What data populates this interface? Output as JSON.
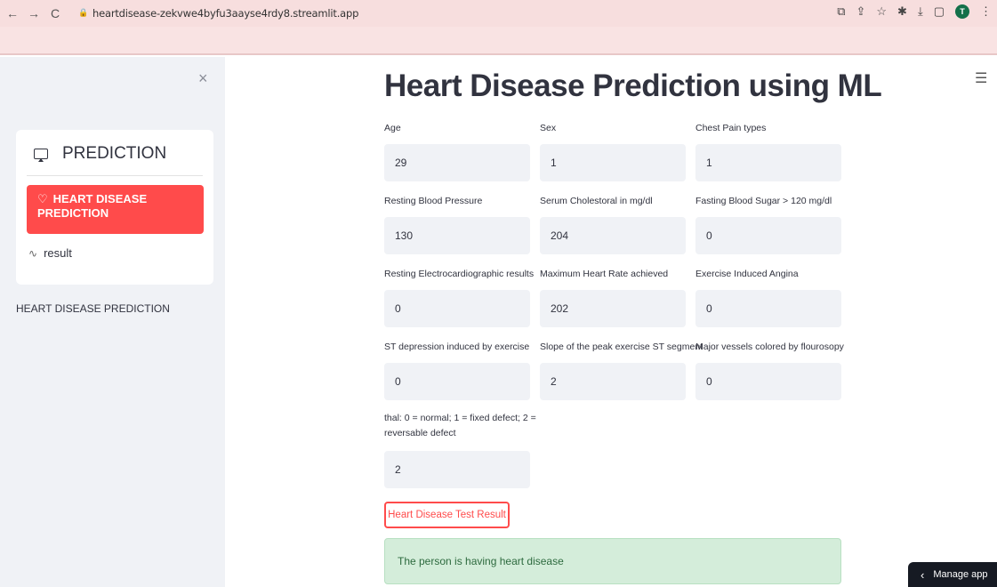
{
  "browser": {
    "url": "heartdisease-zekvwe4byfu3aayse4rdy8.streamlit.app",
    "back": "←",
    "forward": "→",
    "reload": "C",
    "avatar_letter": "T"
  },
  "sidebar": {
    "close_icon": "×",
    "menu_title": "PREDICTION",
    "items": [
      {
        "label": "HEART DISEASE PREDICTION",
        "icon": "heart-icon",
        "active": true
      },
      {
        "label": "result",
        "icon": "pulse-icon",
        "active": false
      }
    ],
    "caption": "HEART DISEASE PREDICTION"
  },
  "main": {
    "title": "Heart Disease Prediction using ML",
    "fields": [
      {
        "label": "Age",
        "value": "29"
      },
      {
        "label": "Sex",
        "value": "1"
      },
      {
        "label": "Chest Pain types",
        "value": "1"
      },
      {
        "label": "Resting Blood Pressure",
        "value": "130"
      },
      {
        "label": "Serum Cholestoral in mg/dl",
        "value": "204"
      },
      {
        "label": "Fasting Blood Sugar > 120 mg/dl",
        "value": "0"
      },
      {
        "label": "Resting Electrocardiographic results",
        "value": "0"
      },
      {
        "label": "Maximum Heart Rate achieved",
        "value": "202"
      },
      {
        "label": "Exercise Induced Angina",
        "value": "0"
      },
      {
        "label": "ST depression induced by exercise",
        "value": "0"
      },
      {
        "label": "Slope of the peak exercise ST segment",
        "value": "2"
      },
      {
        "label": "Major vessels colored by flourosopy",
        "value": "0"
      },
      {
        "label_line1": "thal: 0 = normal; 1 = fixed defect; 2 =",
        "label_line2": "reversable defect",
        "value": "2"
      }
    ],
    "submit_label": "Heart Disease Test Result",
    "result_text": "The person is having heart disease"
  },
  "footer": {
    "manage_app": "Manage app"
  },
  "colors": {
    "accent": "#ff4b4b",
    "sidebar_bg": "#f0f2f6",
    "success_bg": "#d4edda",
    "browser_bar": "#f7dede"
  }
}
